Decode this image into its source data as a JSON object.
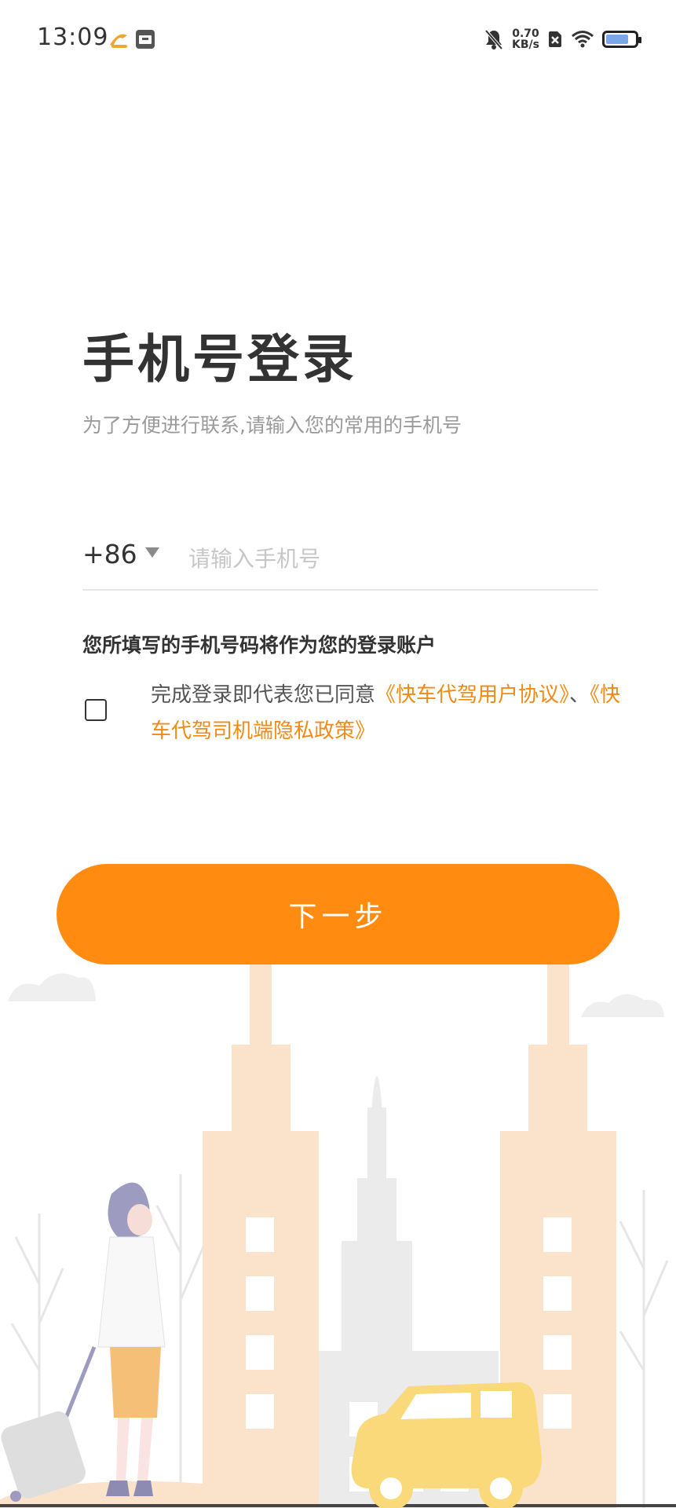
{
  "status_bar": {
    "time": "13:09",
    "net_speed_value": "0.70",
    "net_speed_unit": "KB/s",
    "icons": [
      "app-icon-1",
      "app-icon-2",
      "mute-bell-icon",
      "sim-off-icon",
      "wifi-icon",
      "battery-icon"
    ]
  },
  "login": {
    "title": "手机号登录",
    "subtitle": "为了方便进行联系,请输入您的常用的手机号",
    "country_code": "+86",
    "phone_placeholder": "请输入手机号",
    "phone_value": "",
    "account_note": "您所填写的手机号码将作为您的登录账户",
    "agreement_prefix": "完成登录即代表您已同意",
    "agreement_link1": "《快车代驾用户协议》",
    "agreement_separator": "、",
    "agreement_link2": "《快车代驾司机端隐私政策》",
    "next_button": "下一步"
  },
  "colors": {
    "accent": "#ff8c10",
    "link": "#f28a14",
    "building_peach": "#fbe3cb",
    "building_gray": "#e9e9e9",
    "car_yellow": "#f9d97a"
  }
}
